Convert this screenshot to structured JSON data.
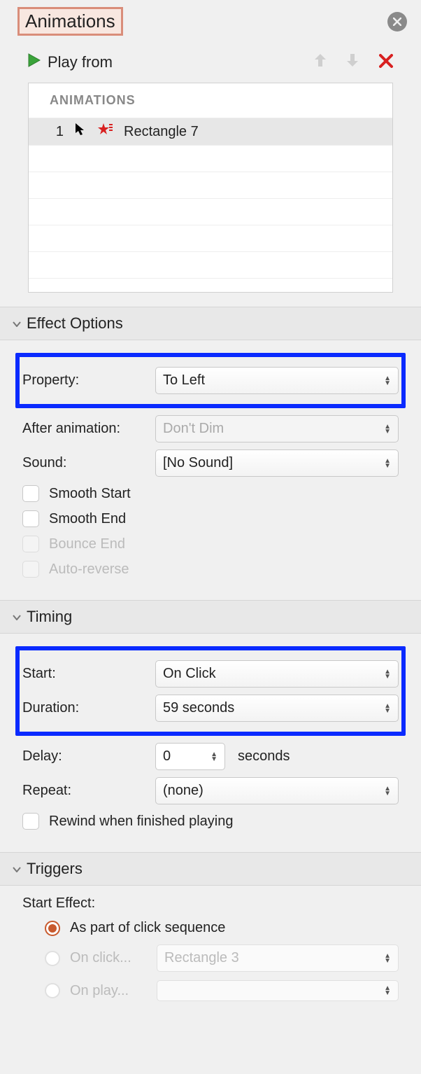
{
  "header": {
    "title": "Animations"
  },
  "playbar": {
    "label": "Play from"
  },
  "animlist": {
    "header": "ANIMATIONS",
    "items": [
      {
        "index": "1",
        "name": "Rectangle 7"
      }
    ]
  },
  "effect": {
    "title": "Effect Options",
    "property_label": "Property:",
    "property_value": "To Left",
    "after_label": "After animation:",
    "after_value": "Don't Dim",
    "sound_label": "Sound:",
    "sound_value": "[No Sound]",
    "smooth_start": "Smooth Start",
    "smooth_end": "Smooth End",
    "bounce_end": "Bounce End",
    "auto_reverse": "Auto-reverse"
  },
  "timing": {
    "title": "Timing",
    "start_label": "Start:",
    "start_value": "On Click",
    "duration_label": "Duration:",
    "duration_value": "59 seconds",
    "delay_label": "Delay:",
    "delay_value": "0",
    "delay_suffix": "seconds",
    "repeat_label": "Repeat:",
    "repeat_value": "(none)",
    "rewind": "Rewind when finished playing"
  },
  "triggers": {
    "title": "Triggers",
    "start_effect": "Start Effect:",
    "opt_sequence": "As part of click sequence",
    "opt_onclick": "On click...",
    "onclick_value": "Rectangle 3",
    "opt_onplay": "On play...",
    "onplay_value": ""
  }
}
